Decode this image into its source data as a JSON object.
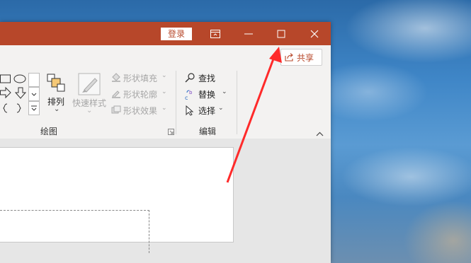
{
  "titlebar": {
    "login_label": "登录",
    "ribbon_display_icon": "ribbon-display-options-icon",
    "minimize_icon": "minimize-icon",
    "maximize_icon": "maximize-icon",
    "close_icon": "close-icon",
    "color": "#b7472a"
  },
  "share": {
    "label": "共享",
    "icon": "share-icon"
  },
  "ribbon": {
    "arrange": {
      "label": "排列",
      "chevron": "⌄"
    },
    "quick_styles": {
      "label": "快速样式"
    },
    "format": {
      "shape_fill": "形状填充",
      "shape_outline": "形状轮廓",
      "shape_effects": "形状效果"
    },
    "groups": {
      "drawing": "绘图",
      "editing": "编辑"
    },
    "editing": {
      "find": "查找",
      "replace": "替换",
      "select": "选择"
    }
  },
  "annotation": {
    "color": "#ff2020"
  }
}
